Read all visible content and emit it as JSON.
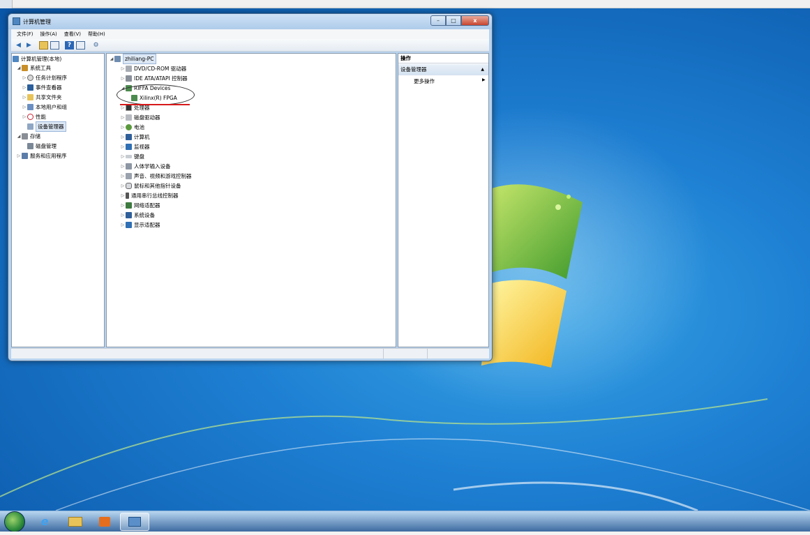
{
  "window": {
    "title": "计算机管理",
    "minimize_icon": "minimize-icon",
    "maximize_icon": "maximize-icon",
    "close_icon": "close-icon"
  },
  "menubar": {
    "items": [
      "文件(F)",
      "操作(A)",
      "查看(V)",
      "帮助(H)"
    ]
  },
  "toolbar": {
    "icons": [
      "back-arrow-icon",
      "forward-arrow-icon",
      "up-folder-icon",
      "console-tree-icon",
      "help-icon",
      "properties-icon",
      "scan-hardware-icon"
    ]
  },
  "left_tree": {
    "root": "计算机管理(本地)",
    "system_tools": "系统工具",
    "task_scheduler": "任务计划程序",
    "event_viewer": "事件查看器",
    "shared_folders": "共享文件夹",
    "local_users": "本地用户和组",
    "performance": "性能",
    "device_manager": "设备管理器",
    "storage": "存储",
    "disk_management": "磁盘管理",
    "services_apps": "服务和应用程序"
  },
  "device_tree": {
    "root": "zhiliang-PC",
    "categories": [
      "DVD/CD-ROM 驱动器",
      "IDE ATA/ATAPI 控制器",
      "RIFFA Devices",
      "Xilinx(R) FPGA",
      "处理器",
      "磁盘驱动器",
      "电池",
      "计算机",
      "监视器",
      "键盘",
      "人体学输入设备",
      "声音、视频和游戏控制器",
      "鼠标和其他指针设备",
      "通用串行总线控制器",
      "网络适配器",
      "系统设备",
      "显示适配器"
    ]
  },
  "actions": {
    "header": "操作",
    "section": "设备管理器",
    "more": "更多操作"
  },
  "taskbar": {
    "items": [
      "start-orb-icon",
      "internet-explorer-icon",
      "file-explorer-icon",
      "media-player-icon",
      "computer-management-icon"
    ]
  }
}
